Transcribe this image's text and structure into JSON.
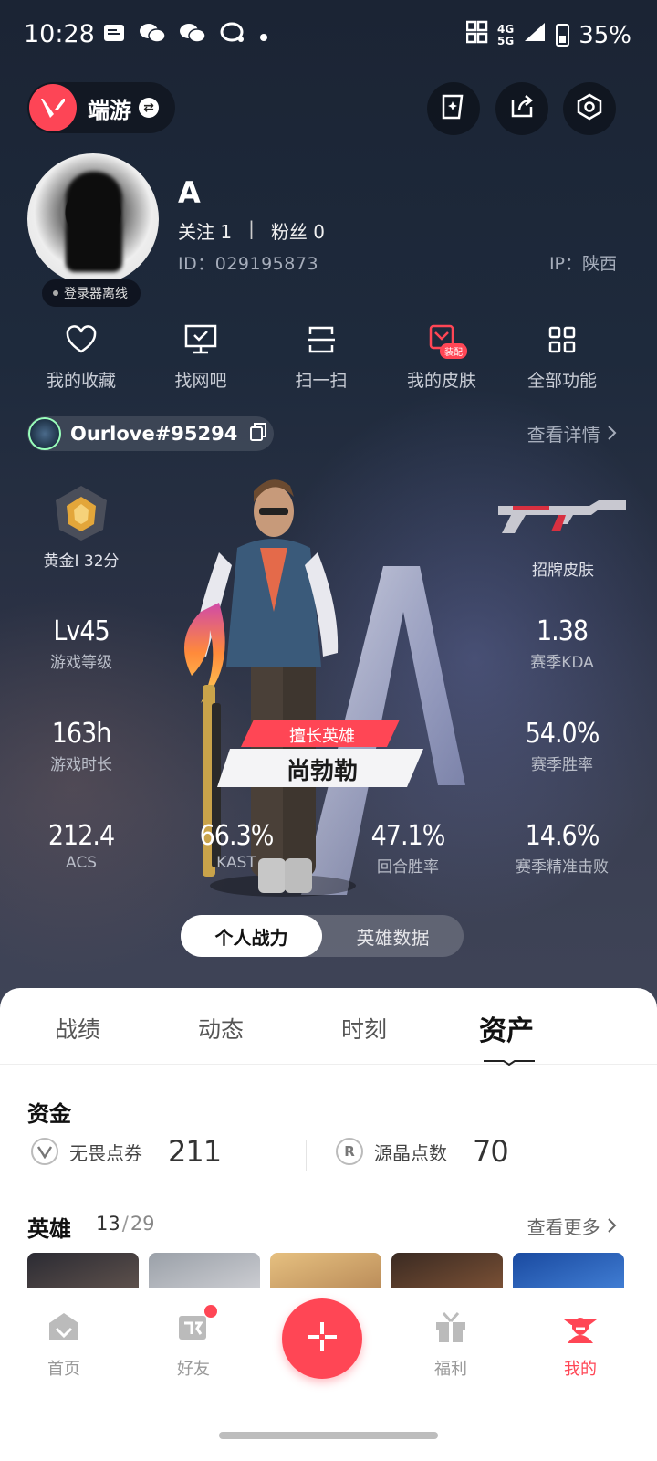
{
  "status_bar": {
    "time": "10:28",
    "network_top": "4G",
    "network_bottom": "5G",
    "battery": "35%"
  },
  "header": {
    "mode_label": "端游",
    "icons": [
      "card-icon",
      "share-icon",
      "settings-icon"
    ]
  },
  "profile": {
    "name": "A",
    "follow_label": "关注",
    "follow_count": "1",
    "separator": "|",
    "fans_label": "粉丝",
    "fans_count": "0",
    "id": "ID：029195873",
    "ip": "IP：陕西",
    "status": "登录器离线"
  },
  "quick_actions": [
    {
      "label": "我的收藏",
      "icon": "heart-icon"
    },
    {
      "label": "找网吧",
      "icon": "monitor-icon"
    },
    {
      "label": "扫一扫",
      "icon": "scan-icon"
    },
    {
      "label": "我的皮肤",
      "icon": "skin-icon",
      "badge": "装配"
    },
    {
      "label": "全部功能",
      "icon": "grid-icon"
    }
  ],
  "game_account": {
    "riot_id": "Ourlove#95294",
    "detail_link": "查看详情"
  },
  "stats": {
    "rank": {
      "label": "黄金I 32分"
    },
    "skin": {
      "label": "招牌皮肤"
    },
    "level": {
      "value": "Lv45",
      "label": "游戏等级"
    },
    "kda": {
      "value": "1.38",
      "label": "赛季KDA"
    },
    "playtime": {
      "value": "163h",
      "label": "游戏时长"
    },
    "winrate": {
      "value": "54.0%",
      "label": "赛季胜率"
    },
    "acs": {
      "value": "212.4",
      "label": "ACS"
    },
    "kast": {
      "value": "66.3%",
      "label": "KAST"
    },
    "round_win": {
      "value": "47.1%",
      "label": "回合胜率"
    },
    "precision": {
      "value": "14.6%",
      "label": "赛季精准击败"
    }
  },
  "best_hero": {
    "tag": "擅长英雄",
    "name": "尚勃勒"
  },
  "segment": {
    "options": [
      "个人战力",
      "英雄数据"
    ],
    "active": "个人战力"
  },
  "tabs": {
    "items": [
      "战绩",
      "动态",
      "时刻",
      "资产"
    ],
    "active": "资产"
  },
  "funds": {
    "title": "资金",
    "items": [
      {
        "label": "无畏点券",
        "value": "211"
      },
      {
        "label": "源晶点数",
        "value": "70",
        "icon_text": "R"
      }
    ]
  },
  "heroes": {
    "title": "英雄",
    "owned": "13",
    "slash": "/",
    "total": "29",
    "more": "查看更多"
  },
  "tabbar": {
    "items": [
      {
        "label": "首页",
        "icon": "home-icon"
      },
      {
        "label": "好友",
        "icon": "friends-icon"
      },
      {
        "label": "福利",
        "icon": "gift-icon"
      },
      {
        "label": "我的",
        "icon": "profile-icon"
      }
    ],
    "active": "我的"
  },
  "colors": {
    "accent": "#ff4655",
    "sheet": "#ffffff",
    "hero_bg": "#1e2a3c"
  }
}
